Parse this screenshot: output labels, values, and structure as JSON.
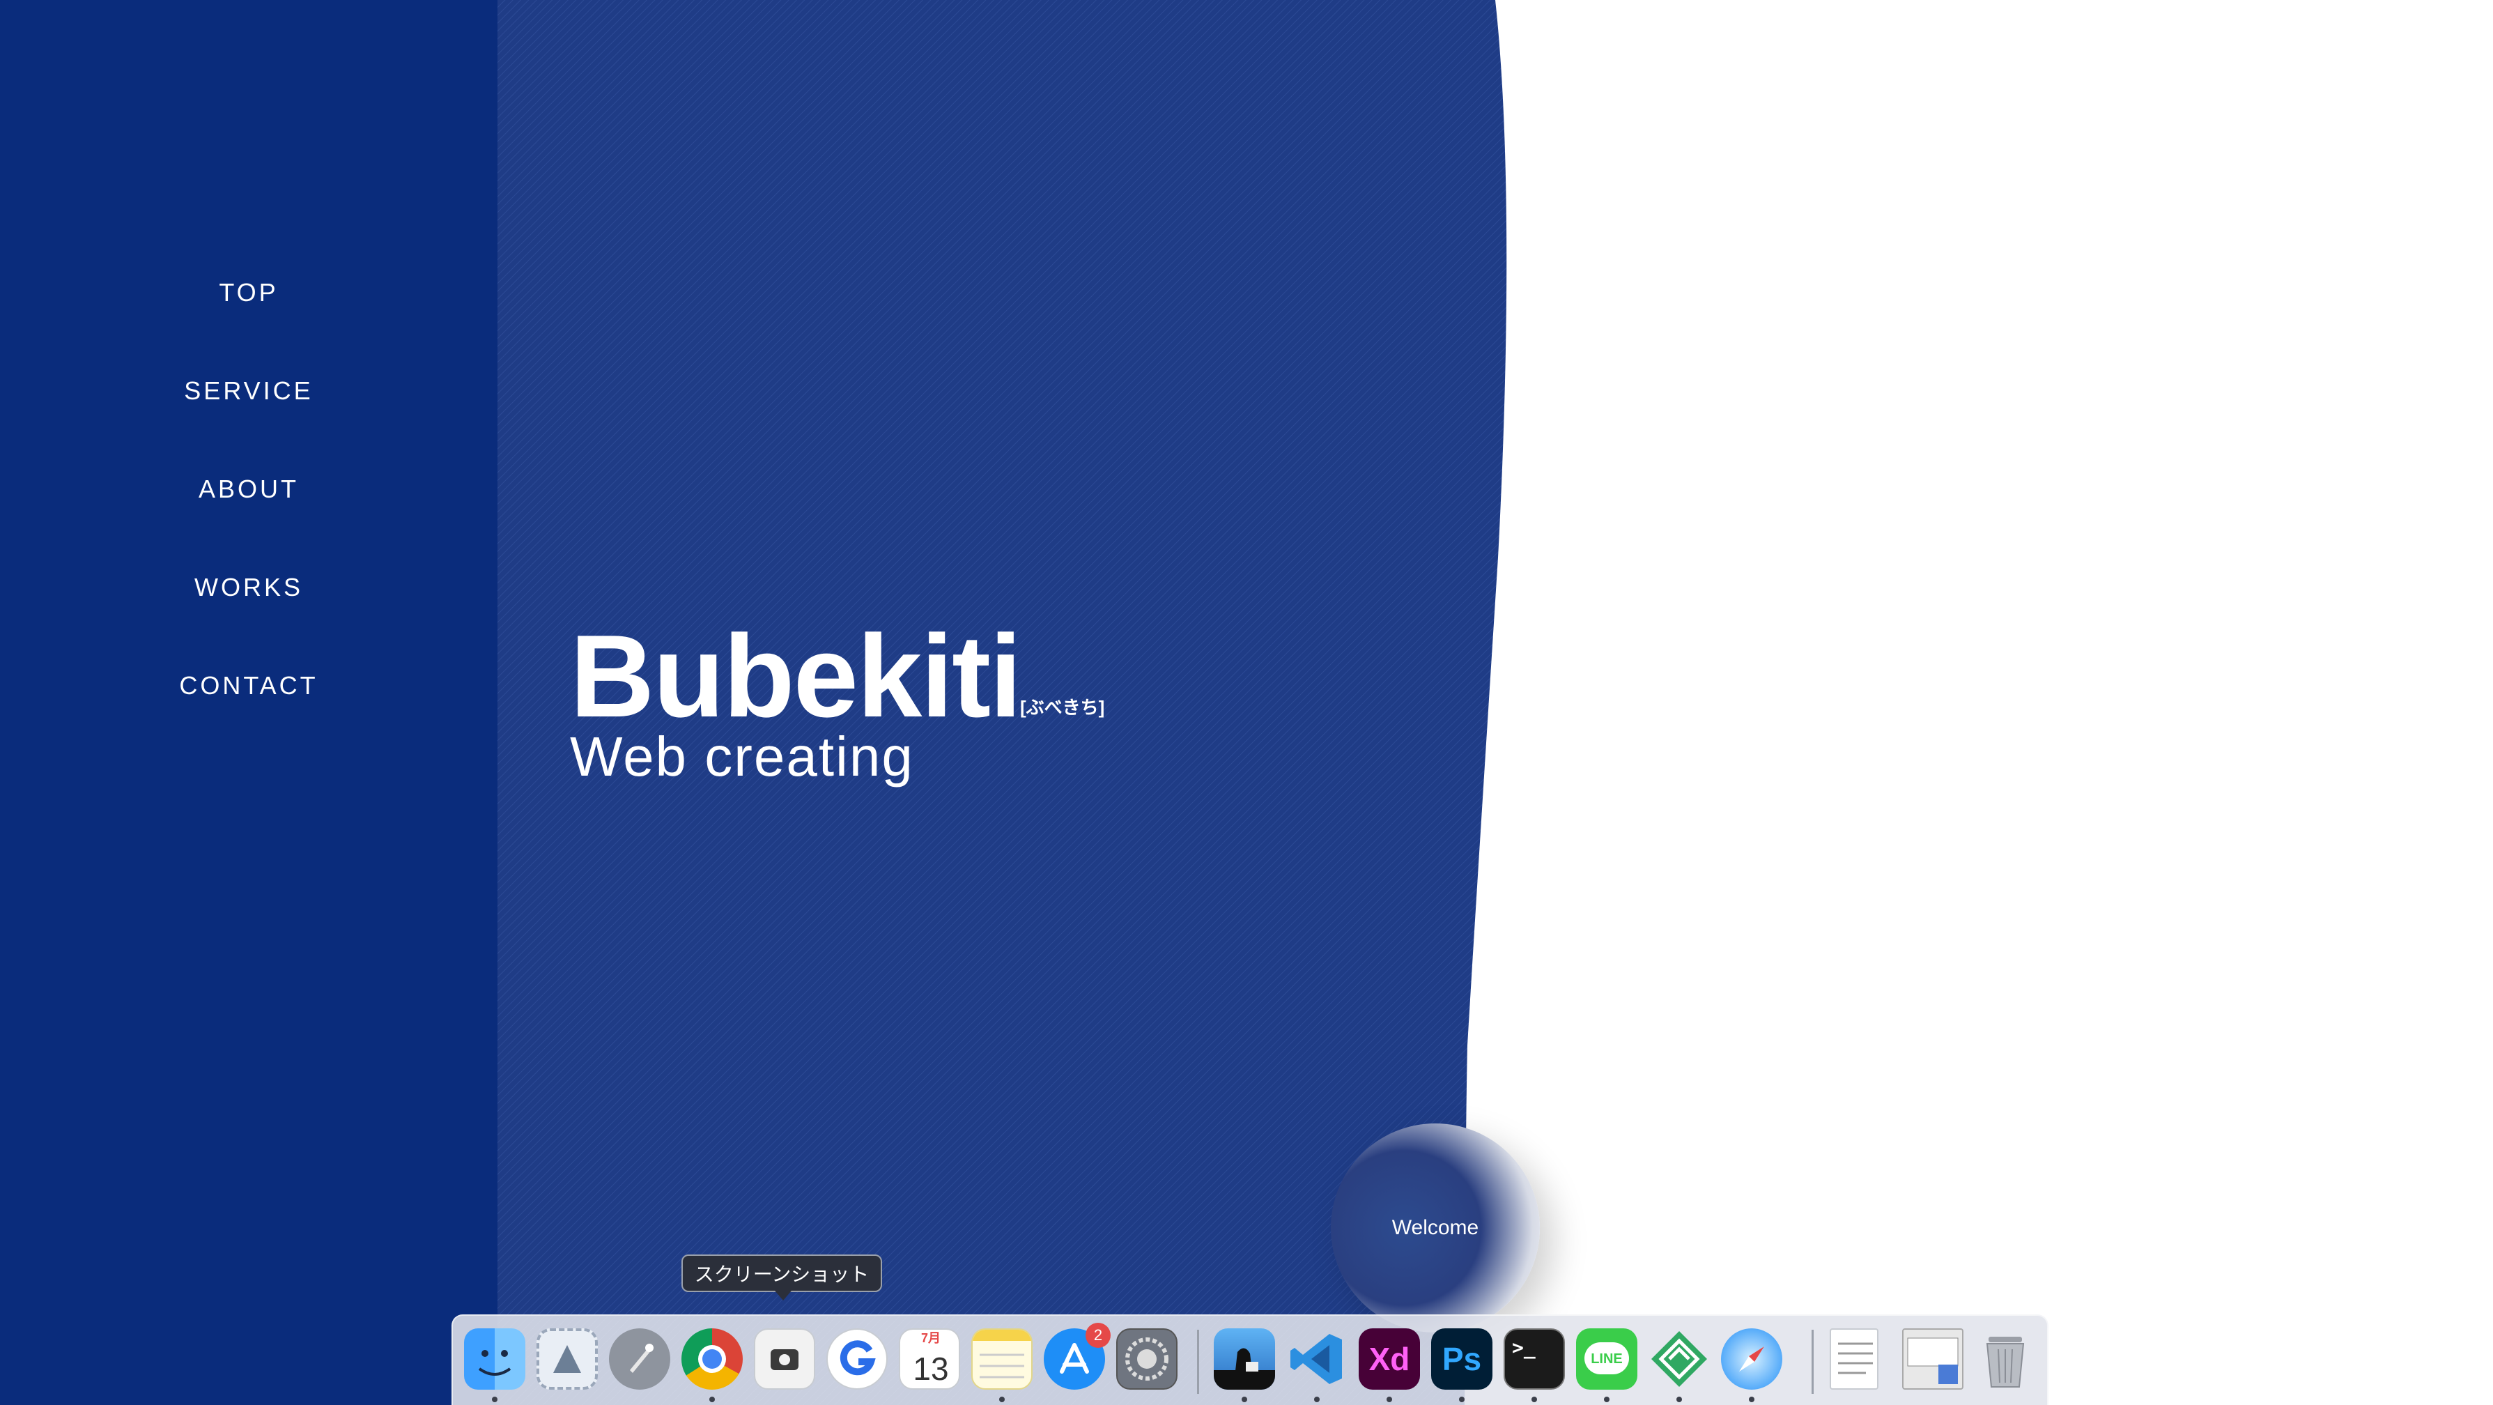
{
  "nav": {
    "items": [
      {
        "label": "TOP"
      },
      {
        "label": "SERVICE"
      },
      {
        "label": "ABOUT"
      },
      {
        "label": "WORKS"
      },
      {
        "label": "CONTACT"
      }
    ]
  },
  "hero": {
    "title": "Bubekiti",
    "subtitle": "[ぶべきち]",
    "tagline": "Web creating"
  },
  "welcome": {
    "label": "Welcome"
  },
  "dock": {
    "tooltip": "スクリーンショット",
    "calendar": {
      "month": "7月",
      "day": "13"
    },
    "app_store_badge": "2",
    "xd_label": "Xd",
    "ps_label": "Ps",
    "terminal_prompt": ">_",
    "line_label": "LINE"
  },
  "colors": {
    "sidebar": "#0a2c7c",
    "hero": "#1d3a83",
    "accent_white": "#ffffff"
  }
}
